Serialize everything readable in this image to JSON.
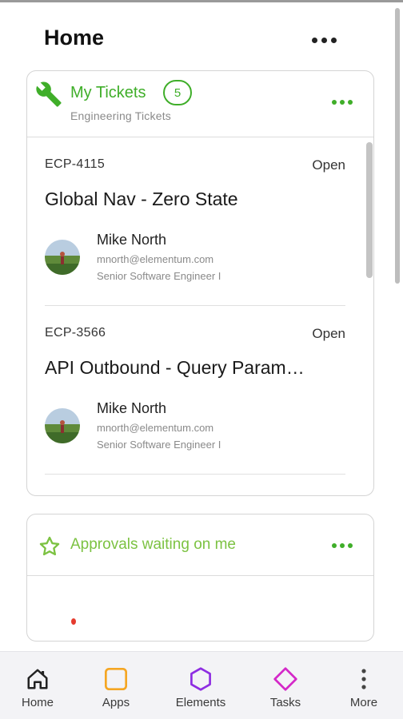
{
  "header": {
    "title": "Home"
  },
  "tickets_card": {
    "title": "My Tickets",
    "count": "5",
    "subtitle": "Engineering Tickets",
    "items": [
      {
        "id": "ECP-4115",
        "status": "Open",
        "name": "Global Nav - Zero State",
        "person": {
          "name": "Mike North",
          "email": "mnorth@elementum.com",
          "role": "Senior Software Engineer I"
        }
      },
      {
        "id": "ECP-3566",
        "status": "Open",
        "name": "API Outbound - Query Param…",
        "person": {
          "name": "Mike North",
          "email": "mnorth@elementum.com",
          "role": "Senior Software Engineer I"
        }
      }
    ]
  },
  "approvals_card": {
    "title": "Approvals waiting on me"
  },
  "bottom_nav": {
    "items": [
      {
        "label": "Home",
        "icon": "home-icon",
        "color": "#222222"
      },
      {
        "label": "Apps",
        "icon": "apps-icon",
        "color": "#f5a623"
      },
      {
        "label": "Elements",
        "icon": "elements-icon",
        "color": "#8e2de2"
      },
      {
        "label": "Tasks",
        "icon": "tasks-icon",
        "color": "#d428c8"
      },
      {
        "label": "More",
        "icon": "more-vertical-icon",
        "color": "#444444"
      }
    ]
  },
  "colors": {
    "accent_green": "#3fae29",
    "approvals_green": "#7cc242"
  }
}
